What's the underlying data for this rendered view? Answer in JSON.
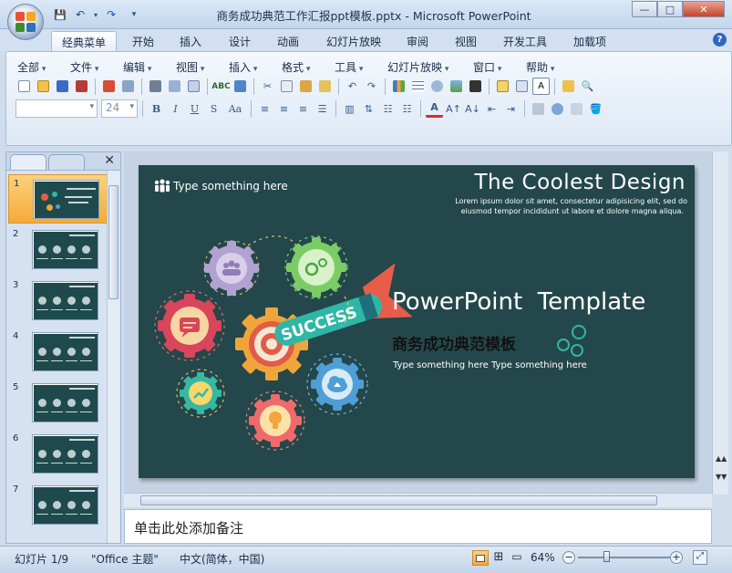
{
  "window": {
    "title": "商务成功典范工作汇报ppt模板.pptx - Microsoft PowerPoint",
    "min": "—",
    "restore": "□",
    "close": "✕"
  },
  "qat": {
    "save": "💾",
    "undo": "↶",
    "redo": "↷",
    "customize": "▾"
  },
  "tabs": [
    "经典菜单",
    "开始",
    "插入",
    "设计",
    "动画",
    "幻灯片放映",
    "审阅",
    "视图",
    "开发工具",
    "加载项"
  ],
  "help": "?",
  "menus": [
    "全部",
    "文件",
    "编辑",
    "视图",
    "插入",
    "格式",
    "工具",
    "幻灯片放映",
    "窗口",
    "帮助"
  ],
  "format": {
    "font_name": "",
    "font_size": "24"
  },
  "slides_panel": {
    "count": 7,
    "numbers": [
      "1",
      "2",
      "3",
      "4",
      "5",
      "6",
      "7"
    ],
    "selected": 1
  },
  "slide": {
    "people_caption": "Type something here",
    "main_title": "The Coolest Design",
    "lorem_1": "Lorem ipsum dolor sit amet, consectetur adipisicing elit, sed do",
    "lorem_2": "eiusmod tempor incididunt ut labore et dolore magna aliqua.",
    "template_title": "PowerPoint  Template",
    "cn_title": "商务成功典范模板",
    "tagline": "Type something here Type something here",
    "success": "SUCCESS"
  },
  "notes": {
    "placeholder": "单击此处添加备注"
  },
  "status": {
    "slide_info": "幻灯片 1/9",
    "theme": "\"Office 主题\"",
    "language": "中文(简体，中国)",
    "zoom": "64%"
  },
  "zoom_level": 0.64,
  "colors": {
    "slide_bg": "#24474b",
    "accent_orange": "#f0a53a",
    "teal": "#2fb7a6",
    "coral": "#e85c4a"
  }
}
